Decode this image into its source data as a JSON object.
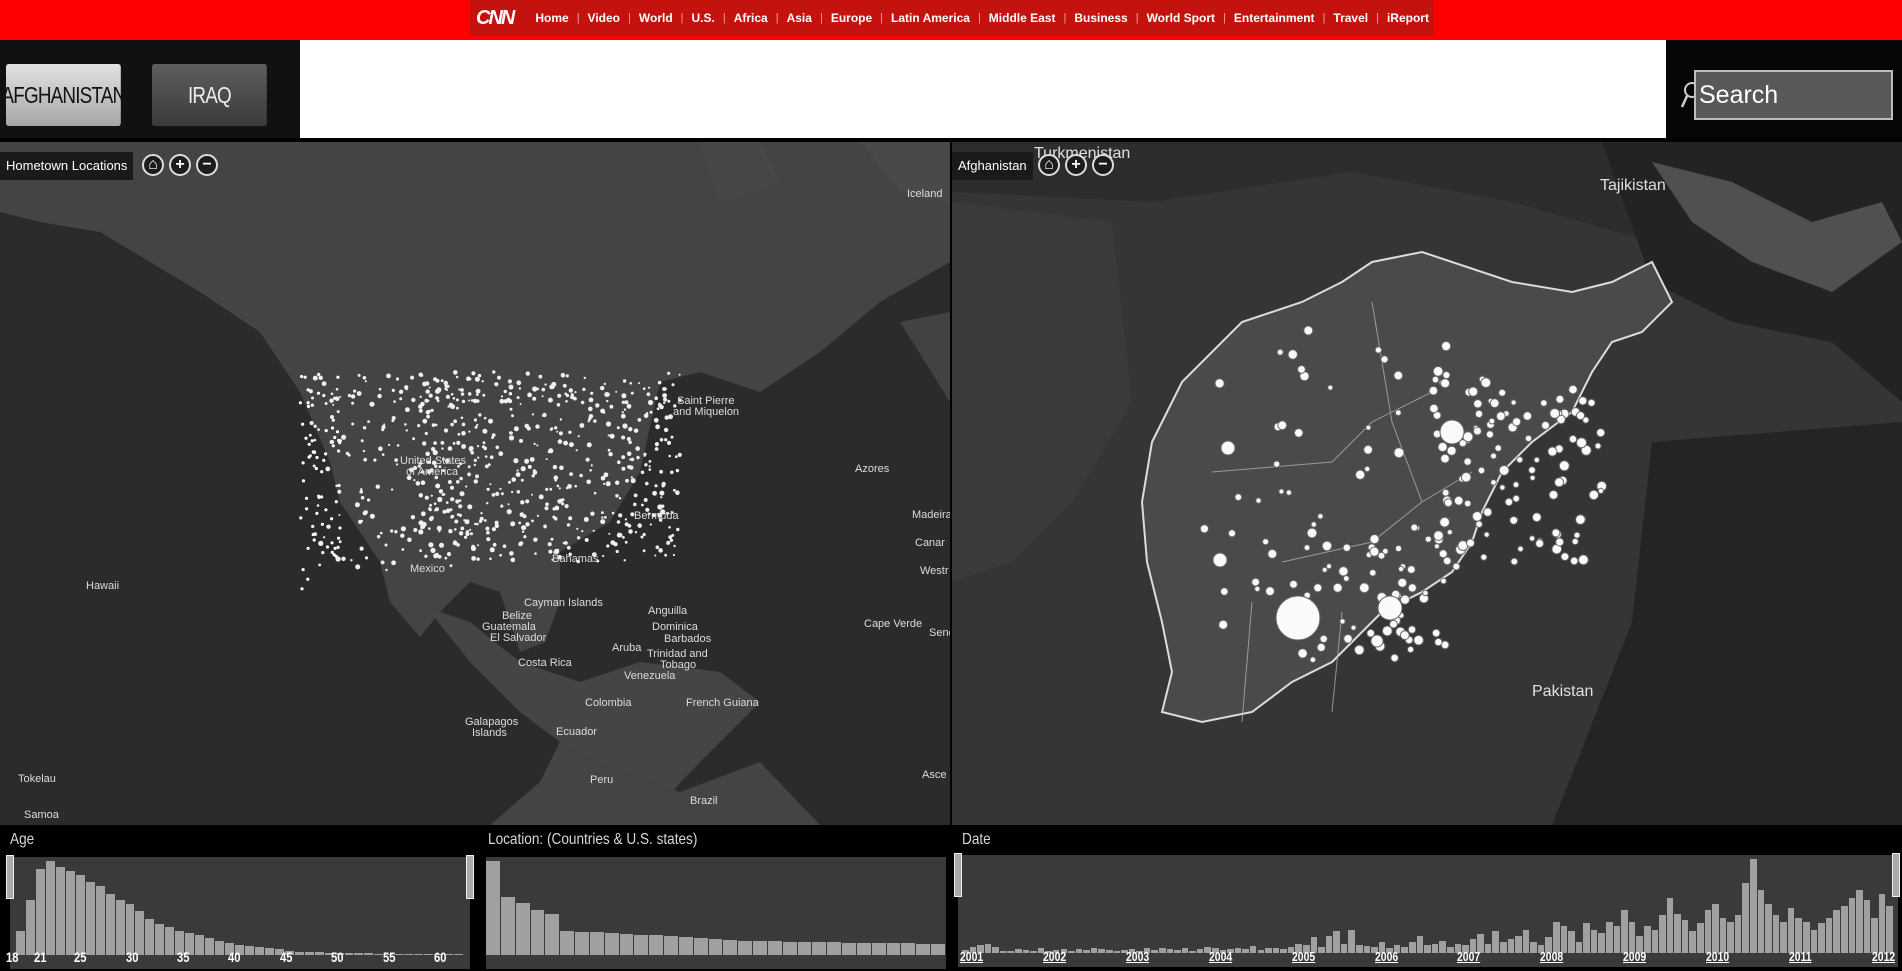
{
  "topnav": {
    "logo": "CNN",
    "items": [
      "Home",
      "Video",
      "World",
      "U.S.",
      "Africa",
      "Asia",
      "Europe",
      "Latin America",
      "Middle East",
      "Business",
      "World Sport",
      "Entertainment",
      "Travel",
      "iReport"
    ]
  },
  "tabs": {
    "afghanistan": "AFGHANISTAN",
    "iraq": "IRAQ"
  },
  "search": {
    "placeholder": "Search"
  },
  "map_us": {
    "label": "Hometown Locations",
    "places": [
      {
        "t": "Iceland"
      },
      {
        "t": "United States"
      },
      {
        "t": "of America"
      },
      {
        "t": "Saint Pierre"
      },
      {
        "t": "and Miquelon"
      },
      {
        "t": "Azores"
      },
      {
        "t": "Bermuda"
      },
      {
        "t": "Madeira"
      },
      {
        "t": "Canar"
      },
      {
        "t": "Westr"
      },
      {
        "t": "Mexico"
      },
      {
        "t": "Bahamas"
      },
      {
        "t": "Hawaii"
      },
      {
        "t": "Cayman Islands"
      },
      {
        "t": "Anguilla"
      },
      {
        "t": "Belize"
      },
      {
        "t": "Guatemala"
      },
      {
        "t": "El Salvador"
      },
      {
        "t": "Dominica"
      },
      {
        "t": "Barbados"
      },
      {
        "t": "Cape Verde"
      },
      {
        "t": "Sene"
      },
      {
        "t": "Aruba"
      },
      {
        "t": "Trinidad and"
      },
      {
        "t": "Tobago"
      },
      {
        "t": "Costa Rica"
      },
      {
        "t": "Venezuela"
      },
      {
        "t": "Colombia"
      },
      {
        "t": "French Guiana"
      },
      {
        "t": "Galapagos"
      },
      {
        "t": "Islands"
      },
      {
        "t": "Ecuador"
      },
      {
        "t": "Peru"
      },
      {
        "t": "Brazil"
      },
      {
        "t": "Tokelau"
      },
      {
        "t": "Samoa"
      },
      {
        "t": "Asce"
      }
    ]
  },
  "map_afg": {
    "label": "Afghanistan",
    "places": [
      {
        "t": "Turkmenistan"
      },
      {
        "t": "Tajikistan"
      },
      {
        "t": "Pakistan"
      }
    ]
  },
  "filters": {
    "age": {
      "title": "Age",
      "ticks": [
        "18",
        "21",
        "25",
        "30",
        "35",
        "40",
        "45",
        "50",
        "55",
        "60"
      ],
      "counts": [
        22,
        50,
        78,
        85,
        80,
        76,
        72,
        66,
        62,
        55,
        50,
        46,
        40,
        33,
        28,
        25,
        22,
        20,
        18,
        15,
        13,
        11,
        9,
        8,
        7,
        6,
        5,
        4,
        3,
        3,
        3,
        2,
        2,
        2,
        2,
        2,
        1,
        1,
        1,
        1,
        1,
        1,
        1,
        1,
        1
      ]
    },
    "location": {
      "title": "Location: (Countries & U.S. states)",
      "counts": [
        100,
        62,
        55,
        48,
        44,
        26,
        25,
        24,
        23,
        22,
        21,
        21,
        20,
        19,
        18,
        17,
        16,
        15,
        15,
        15,
        14,
        14,
        14,
        14,
        13,
        13,
        13,
        13,
        13,
        12,
        12
      ]
    },
    "date": {
      "title": "Date",
      "ticks": [
        "2001",
        "2002",
        "2003",
        "2004",
        "2005",
        "2006",
        "2007",
        "2008",
        "2009",
        "2010",
        "2011",
        "2012"
      ],
      "counts": [
        4,
        8,
        10,
        12,
        8,
        2,
        3,
        5,
        4,
        3,
        6,
        3,
        4,
        5,
        3,
        5,
        4,
        6,
        5,
        4,
        3,
        4,
        5,
        3,
        6,
        4,
        7,
        5,
        4,
        6,
        3,
        5,
        8,
        6,
        4,
        5,
        7,
        5,
        9,
        4,
        6,
        7,
        5,
        8,
        12,
        10,
        20,
        8,
        22,
        28,
        12,
        30,
        10,
        9,
        8,
        14,
        6,
        10,
        8,
        14,
        22,
        10,
        12,
        15,
        8,
        12,
        10,
        18,
        24,
        12,
        28,
        14,
        18,
        22,
        30,
        14,
        10,
        20,
        40,
        35,
        28,
        14,
        38,
        30,
        25,
        40,
        35,
        55,
        40,
        22,
        35,
        30,
        48,
        70,
        50,
        42,
        28,
        38,
        55,
        62,
        45,
        40,
        48,
        90,
        120,
        80,
        62,
        48,
        40,
        58,
        45,
        40,
        30,
        38,
        45,
        55,
        60,
        70,
        80,
        68,
        45,
        75,
        60
      ]
    }
  }
}
